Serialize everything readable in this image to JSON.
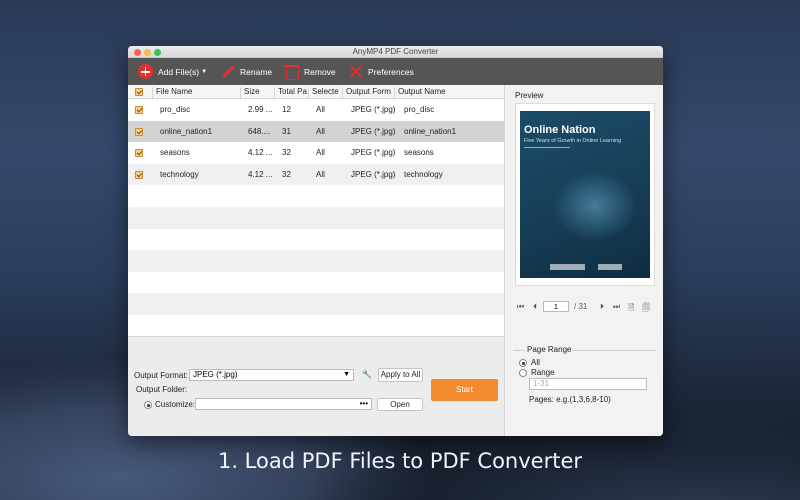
{
  "window": {
    "title": "AnyMP4 PDF Converter"
  },
  "toolbar": {
    "add_label": "Add File(s)",
    "rename_label": "Rename",
    "remove_label": "Remove",
    "preferences_label": "Preferences"
  },
  "table": {
    "headers": [
      "File Name",
      "Size",
      "Total Pa",
      "Selecte",
      "Output Form",
      "Output Name"
    ],
    "rows": [
      {
        "file": "pro_disc",
        "size": "2.99 ...",
        "total": "12",
        "selected": "All",
        "format": "JPEG (*.jpg)",
        "output": "pro_disc"
      },
      {
        "file": "online_nation1",
        "size": "648....",
        "total": "31",
        "selected": "All",
        "format": "JPEG (*.jpg)",
        "output": "online_nation1"
      },
      {
        "file": "seasons",
        "size": "4.12 ...",
        "total": "32",
        "selected": "All",
        "format": "JPEG (*.jpg)",
        "output": "seasons"
      },
      {
        "file": "technology",
        "size": "4.12 ...",
        "total": "32",
        "selected": "All",
        "format": "JPEG (*.jpg)",
        "output": "technology"
      }
    ]
  },
  "bottom": {
    "output_format_label": "Output Format:",
    "output_format_value": "JPEG (*.jpg)",
    "apply_all": "Apply to All",
    "output_folder_label": "Output Folder:",
    "customize_label": "Customize:",
    "customize_value": "",
    "dots": "•••",
    "open": "Open",
    "start": "Start"
  },
  "preview": {
    "label": "Preview",
    "cover_title": "Online Nation",
    "cover_subtitle": "Five Years of Growth in Online Learning",
    "page_current": "1",
    "page_total": "/ 31"
  },
  "page_range": {
    "label": "Page Range",
    "all": "All",
    "range": "Range",
    "range_placeholder": "1-31",
    "hint": "Pages: e.g.(1,3,6,8-10)"
  },
  "caption": "1. Load PDF Files to PDF Converter"
}
